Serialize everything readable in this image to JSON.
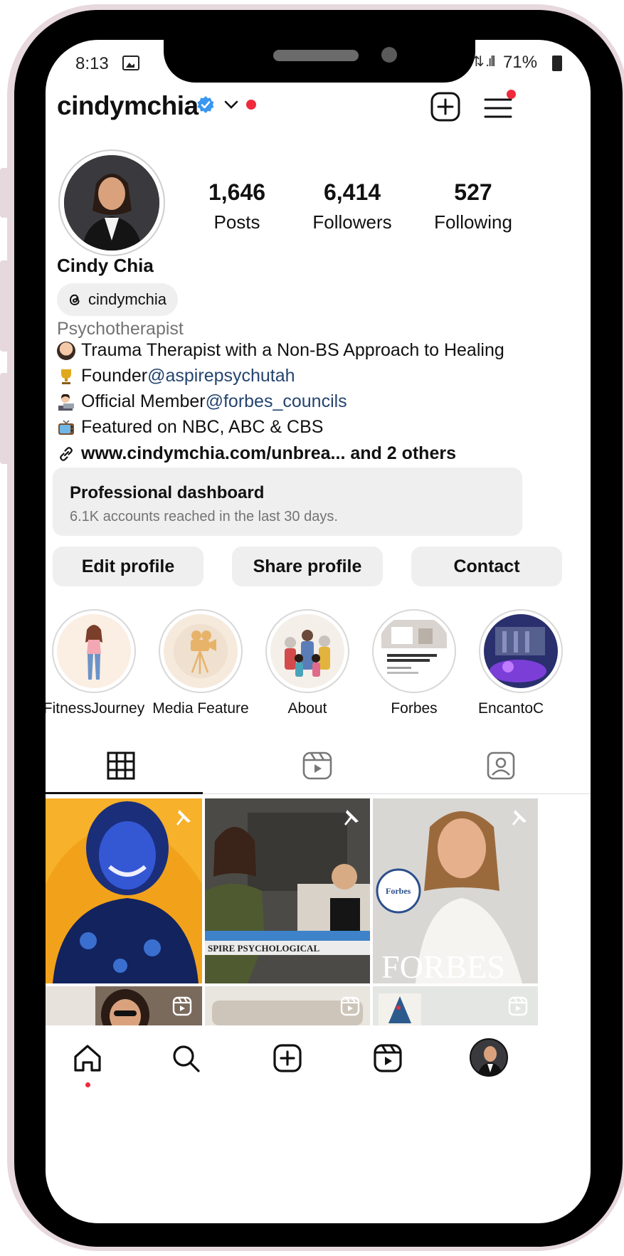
{
  "status_bar": {
    "time": "8:13",
    "battery": "71%"
  },
  "header": {
    "username": "cindymchia",
    "verified": true,
    "accent_color": "#3897f0",
    "notification_color": "#ef2a3c"
  },
  "profile": {
    "display_name": "Cindy Chia",
    "threads_handle": "cindymchia",
    "category": "Psychotherapist",
    "stats": [
      {
        "value": "1,646",
        "label": "Posts"
      },
      {
        "value": "6,414",
        "label": "Followers"
      },
      {
        "value": "527",
        "label": "Following"
      }
    ],
    "bio": [
      {
        "icon": "person-emoji-icon",
        "text": "Trauma Therapist with a Non-BS Approach to Healing",
        "link": ""
      },
      {
        "icon": "trophy-emoji-icon",
        "text": "Founder ",
        "link": "@aspirepsychutah"
      },
      {
        "icon": "technologist-emoji-icon",
        "text": "Official Member ",
        "link": "@forbes_councils"
      },
      {
        "icon": "tv-emoji-icon",
        "text": "Featured on NBC, ABC & CBS",
        "link": ""
      }
    ],
    "website": "www.cindymchia.com/unbrea... and 2 others",
    "link_color": "#24446e"
  },
  "dashboard": {
    "title": "Professional dashboard",
    "subtitle": "6.1K accounts reached in the last 30 days."
  },
  "actions": {
    "edit": "Edit profile",
    "share": "Share profile",
    "contact": "Contact"
  },
  "highlights": [
    {
      "label": "FitnessJourney"
    },
    {
      "label": "Media Feature"
    },
    {
      "label": "About"
    },
    {
      "label": "Forbes"
    },
    {
      "label": "EncantoC"
    }
  ],
  "tabs": [
    {
      "icon": "grid-icon",
      "active": true
    },
    {
      "icon": "reels-icon",
      "active": false
    },
    {
      "icon": "tagged-icon",
      "active": false
    }
  ],
  "posts": [
    {
      "type": "photo",
      "pinned": true,
      "caption": ""
    },
    {
      "type": "photo",
      "pinned": true,
      "caption": "SPIRE PSYCHOLOGICAL"
    },
    {
      "type": "photo",
      "pinned": true,
      "caption": "FORBES"
    },
    {
      "type": "reel",
      "pinned": false,
      "caption": ""
    },
    {
      "type": "reel",
      "pinned": false,
      "caption": ""
    },
    {
      "type": "reel",
      "pinned": false,
      "caption": ""
    }
  ],
  "forbes_badge": "Forbes",
  "bottom_nav": [
    {
      "icon": "home-icon"
    },
    {
      "icon": "search-icon"
    },
    {
      "icon": "create-icon"
    },
    {
      "icon": "reels-icon"
    },
    {
      "icon": "profile-avatar"
    }
  ]
}
